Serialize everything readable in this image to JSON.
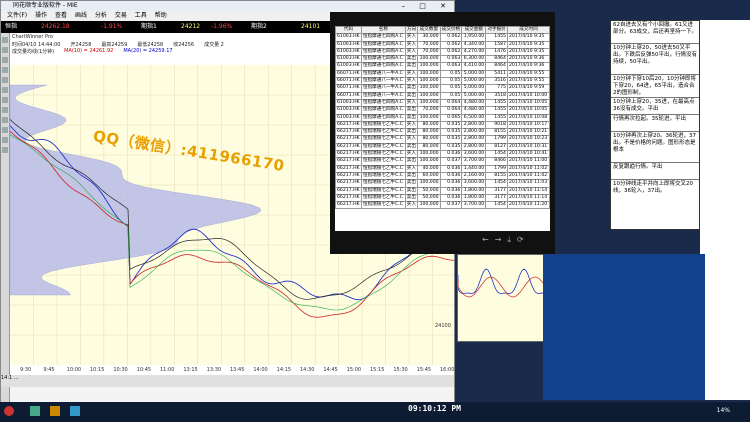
{
  "window_title": "同花顺专业版软件 - MIE",
  "menu": [
    "文件(F)",
    "操作",
    "查看",
    "画线",
    "分析",
    "交易",
    "工具",
    "帮助"
  ],
  "ticker": {
    "label": "恒指",
    "value1": "24262.18",
    "change1": "-1.91%",
    "label2": "期指1",
    "value2": "24212",
    "change2": "-1.96%",
    "label3": "期指2",
    "value3": "24101"
  },
  "chart_header": {
    "product": "ChartWinner Pro",
    "row1": [
      "时间04/10  14:44:00",
      "开24258",
      "最高24259",
      "最低24258",
      "收24256",
      "成交量 2"
    ],
    "row2": [
      "成交量均线(1分钟) ",
      "MA(10) = 24261.92",
      "MA(20) = 24259.17"
    ]
  },
  "price_labels": [
    "24262.9881",
    "24100"
  ],
  "time_ticks": [
    "9:30",
    "9:45",
    "10:00",
    "10:15",
    "10:30",
    "10:45",
    "11:00",
    "13:15",
    "13:30",
    "13:45",
    "14:00",
    "14:15",
    "14:30",
    "14:45",
    "15:00",
    "15:15",
    "15:30",
    "15:45",
    "16:00"
  ],
  "watermark": "QQ（微信）:411966170",
  "clock": "09:10:12 PM",
  "table": {
    "headers": [
      "代码",
      "名称",
      "方向",
      "成交数量",
      "成交价格",
      "成交金额",
      "对手报价",
      "成交时间"
    ],
    "rows": [
      [
        "61003.HK",
        "恒指摩通七四购A.C",
        "买入",
        "30,000",
        "0.062",
        "1,950.00",
        "1455",
        "2017/4/10 9:35"
      ],
      [
        "61003.HK",
        "恒指摩通七四购A.C",
        "买入",
        "70,000",
        "0.062",
        "4,340.00",
        "1587",
        "2017/4/10 9:35"
      ],
      [
        "61003.HK",
        "恒指摩通七四购A.C",
        "买入",
        "70,000",
        "0.062",
        "4,270.00",
        "1476",
        "2017/4/10 9:35"
      ],
      [
        "61003.HK",
        "恒指摩通七四购A.C",
        "卖出",
        "100,000",
        "0.063",
        "6,300.00",
        "8464",
        "2017/4/10 9:36"
      ],
      [
        "61003.HK",
        "恒指摩通七四购A.C",
        "卖出",
        "100,000",
        "0.063",
        "4,410.00",
        "8464",
        "2017/4/10 9:36"
      ],
      [
        "66071.HK",
        "恒指摩通八一牛A.C",
        "买入",
        "100,000",
        "0.05",
        "5,000.00",
        "5411",
        "2017/4/10 9:55"
      ],
      [
        "66071.HK",
        "恒指摩通八一牛A.C",
        "买入",
        "100,000",
        "0.05",
        "5,000.00",
        "3516",
        "2017/4/10 9:55"
      ],
      [
        "66071.HK",
        "恒指摩通八一牛A.C",
        "卖出",
        "100,000",
        "0.05",
        "5,000.00",
        "775",
        "2017/4/10 9:59"
      ],
      [
        "66071.HK",
        "恒指摩通八一牛A.C",
        "卖出",
        "100,000",
        "0.05",
        "5,000.00",
        "3518",
        "2017/4/10 10:00"
      ],
      [
        "61003.HK",
        "恒指摩通七四购A.C",
        "买入",
        "100,000",
        "0.064",
        "4,480.00",
        "1455",
        "2017/4/10 10:05"
      ],
      [
        "61003.HK",
        "恒指摩通七四购A.C",
        "卖出",
        "70,000",
        "0.064",
        "4,480.00",
        "1455",
        "2017/4/10 10:05"
      ],
      [
        "61003.HK",
        "恒指摩通七四购A.C",
        "卖出",
        "100,000",
        "0.065",
        "6,500.00",
        "1455",
        "2017/4/10 10:08"
      ],
      [
        "66217.HK",
        "恒指瑞银七乙牛C.C",
        "买入",
        "80,000",
        "0.035",
        "2,800.00",
        "9018",
        "2017/4/10 10:17"
      ],
      [
        "66217.HK",
        "恒指瑞银七乙牛C.C",
        "卖出",
        "80,000",
        "0.035",
        "2,800.00",
        "8155",
        "2017/4/10 10:21"
      ],
      [
        "66217.HK",
        "恒指瑞银七乙牛C.C",
        "买入",
        "80,000",
        "0.035",
        "2,800.00",
        "1799",
        "2017/4/10 10:23"
      ],
      [
        "66217.HK",
        "恒指瑞银七乙牛C.C",
        "卖出",
        "80,000",
        "0.035",
        "2,800.00",
        "8127",
        "2017/4/10 10:31"
      ],
      [
        "66217.HK",
        "恒指瑞银七乙牛C.C",
        "买入",
        "100,000",
        "0.036",
        "3,600.00",
        "1454",
        "2017/4/10 10:41"
      ],
      [
        "66217.HK",
        "恒指瑞银七乙牛C.C",
        "卖出",
        "100,000",
        "0.037",
        "3,700.00",
        "8466",
        "2017/4/10 11:00"
      ],
      [
        "66217.HK",
        "恒指瑞银七乙牛C.C",
        "买入",
        "40,000",
        "0.036",
        "1,440.00",
        "1799",
        "2017/4/10 11:02"
      ],
      [
        "66217.HK",
        "恒指瑞银七乙牛C.C",
        "卖出",
        "60,000",
        "0.036",
        "2,160.00",
        "8155",
        "2017/4/10 11:02"
      ],
      [
        "66217.HK",
        "恒指瑞银七乙牛C.C",
        "卖出",
        "100,000",
        "0.036",
        "3,600.00",
        "1454",
        "2017/4/10 11:03"
      ],
      [
        "66217.HK",
        "恒指瑞银七乙牛C.C",
        "卖出",
        "50,000",
        "0.036",
        "1,800.00",
        "3177",
        "2017/4/10 11:14"
      ],
      [
        "66217.HK",
        "恒指瑞银七乙牛C.C",
        "卖出",
        "50,000",
        "0.036",
        "1,800.00",
        "3177",
        "2017/4/10 11:14"
      ],
      [
        "66217.HK",
        "恒指瑞银七乙牛C.C",
        "买入",
        "100,000",
        "0.037",
        "3,700.00",
        "1454",
        "2017/4/10 11:20"
      ]
    ]
  },
  "notes": [
    "62自进去又有个小回撤。61又进部分。63成交，后还再坚持一下。",
    "10分钟上穿20，50进去50又平出。下跌后反弹50平出，行情没有持续，50平出。",
    "10分钟下穿10后20，10分钟即将下穿20，64进，65平出，造合合2的图形制，",
    "10分钟上穿20，35进，在最高点36没有成交。平出",
    "行情再次拉起。35轮进，平出",
    "10分钟再次上穿20。36轮进，37出。不是价格的问题。图形形态是根本",
    "反复跟趋行情。平出",
    "10分钟线走平并向上即将交叉20线，36轮入，37出。"
  ],
  "viewer_controls": [
    "back-icon",
    "forward-icon",
    "download-icon",
    "refresh-icon"
  ],
  "status_bar": "14:1 ...",
  "taskbar_right": "14%"
}
